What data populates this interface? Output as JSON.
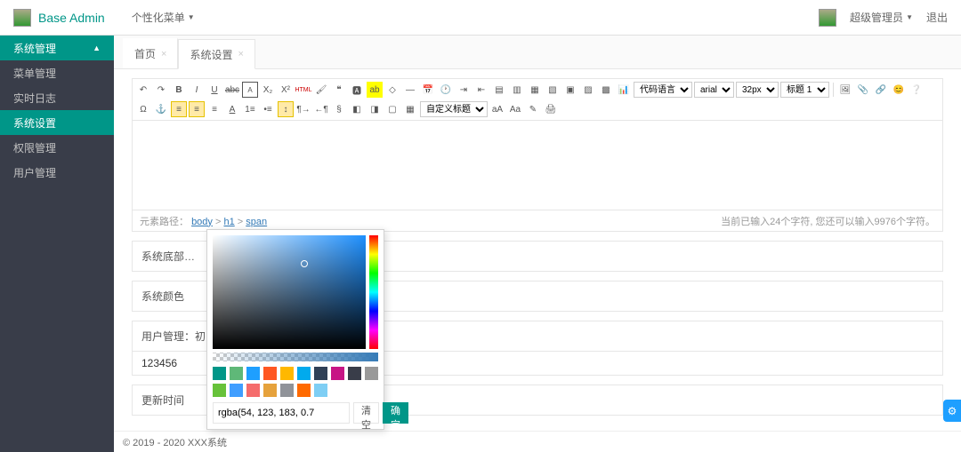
{
  "header": {
    "brand": "Base Admin",
    "personal_menu": "个性化菜单",
    "user_name": "超级管理员",
    "logout": "退出"
  },
  "sidebar": {
    "group": "系统管理",
    "items": [
      "菜单管理",
      "实时日志",
      "系统设置",
      "权限管理",
      "用户管理"
    ],
    "active_index": 2
  },
  "tabs": [
    {
      "label": "首页",
      "closable": true,
      "active": false
    },
    {
      "label": "系统设置",
      "closable": true,
      "active": true
    }
  ],
  "editor": {
    "selects": {
      "code_lang": "代码语言",
      "font": "arial",
      "size": "32px",
      "heading": "标题 1",
      "custom_heading": "自定义标题"
    },
    "path_label": "元素路径：",
    "path_parts": [
      "body",
      "h1",
      "span"
    ],
    "char_count": "当前已输入24个字符, 您还可以输入9976个字符。"
  },
  "form": {
    "footer_label": "系统底部…",
    "footer_value": "© 2019 - 2020 XXX系统",
    "color_label": "系统颜色",
    "user_init_label": "用户管理：初",
    "user_init_value": "123456",
    "update_label": "更新时间"
  },
  "picker": {
    "value": "rgba(54, 123, 183, 0.7",
    "clear": "清空",
    "confirm": "确定",
    "swatches": [
      "#009688",
      "#5fb878",
      "#1e9fff",
      "#ff5722",
      "#ffb800",
      "#01aaed",
      "#2f4056",
      "#c71585",
      "#393d49",
      "#999999",
      "#67c23a",
      "#409eff",
      "#f56c6c",
      "#e6a23c",
      "#909399",
      "#ff6a00",
      "#7ecef4"
    ]
  },
  "footer": "© 2019 - 2020 XXX系统"
}
